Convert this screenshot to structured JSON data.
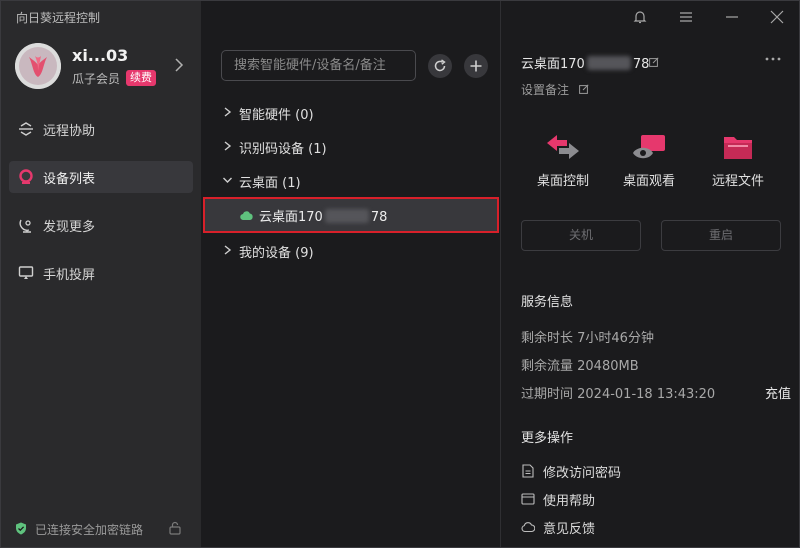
{
  "app": {
    "title": "向日葵远程控制"
  },
  "profile": {
    "name": "xi...03",
    "level": "瓜子会员",
    "badge": "续费"
  },
  "sidebar": {
    "items": [
      {
        "label": "远程协助",
        "icon": "remote-assist-icon",
        "active": false
      },
      {
        "label": "设备列表",
        "icon": "device-list-icon",
        "active": true
      },
      {
        "label": "发现更多",
        "icon": "discover-icon",
        "active": false
      },
      {
        "label": "手机投屏",
        "icon": "screen-cast-icon",
        "active": false
      }
    ],
    "status": "已连接安全加密链路"
  },
  "search": {
    "placeholder": "搜索智能硬件/设备名/备注",
    "value": ""
  },
  "tree": {
    "groups": [
      {
        "label": "智能硬件 (0)",
        "expanded": false
      },
      {
        "label": "识别码设备 (1)",
        "expanded": false
      },
      {
        "label": "云桌面 (1)",
        "expanded": true
      },
      {
        "label": "我的设备 (9)",
        "expanded": false
      }
    ],
    "device": {
      "name_prefix": "云桌面170",
      "name_suffix": "78"
    }
  },
  "detail": {
    "title_prefix": "云桌面170",
    "title_suffix": "78",
    "note": "设置备注",
    "actions": [
      {
        "label": "桌面控制",
        "icon": "desktop-control-icon"
      },
      {
        "label": "桌面观看",
        "icon": "desktop-view-icon"
      },
      {
        "label": "远程文件",
        "icon": "remote-file-icon"
      }
    ],
    "shutdown": "关机",
    "restart": "重启",
    "service": {
      "title": "服务信息",
      "remaining_time": "剩余时长 7小时46分钟",
      "remaining_traffic": "剩余流量 20480MB",
      "expire": "过期时间 2024-01-18 13:43:20",
      "recharge": "充值"
    },
    "more": {
      "title": "更多操作",
      "items": [
        {
          "label": "修改访问密码",
          "icon": "document-icon"
        },
        {
          "label": "使用帮助",
          "icon": "help-window-icon"
        },
        {
          "label": "意见反馈",
          "icon": "feedback-cloud-icon"
        }
      ]
    }
  },
  "colors": {
    "accent": "#e6386d",
    "highlight_border": "#d8202a",
    "online": "#5fc27e"
  }
}
